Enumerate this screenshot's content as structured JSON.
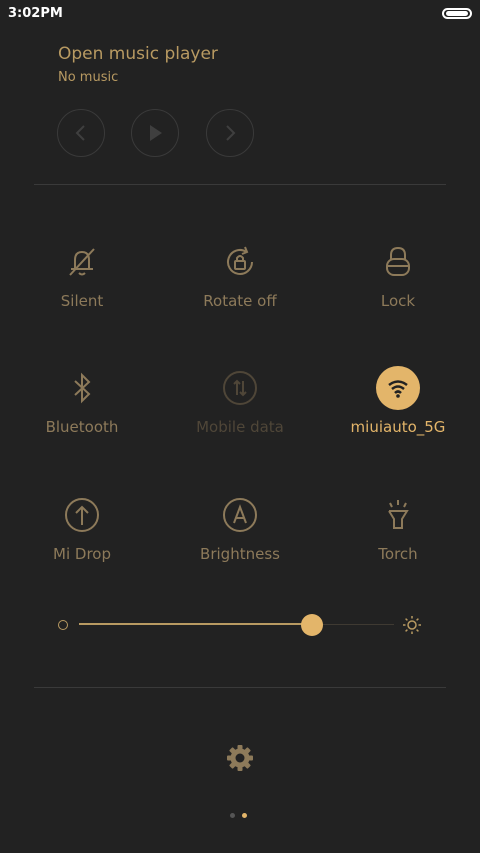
{
  "status": {
    "time": "3:02PM"
  },
  "music": {
    "title": "Open music player",
    "subtitle": "No music"
  },
  "tiles": [
    {
      "label": "Silent",
      "icon": "bell-off-icon",
      "state": "off"
    },
    {
      "label": "Rotate off",
      "icon": "rotate-lock-icon",
      "state": "off"
    },
    {
      "label": "Lock",
      "icon": "lock-icon",
      "state": "off"
    },
    {
      "label": "Bluetooth",
      "icon": "bluetooth-icon",
      "state": "off"
    },
    {
      "label": "Mobile data",
      "icon": "mobile-data-icon",
      "state": "disabled"
    },
    {
      "label": "miuiauto_5G",
      "icon": "wifi-icon",
      "state": "on"
    },
    {
      "label": "Mi Drop",
      "icon": "mi-drop-icon",
      "state": "off"
    },
    {
      "label": "Brightness",
      "icon": "auto-brightness-icon",
      "state": "off"
    },
    {
      "label": "Torch",
      "icon": "torch-icon",
      "state": "off"
    }
  ],
  "brightness": {
    "level": 0.74
  },
  "pager": {
    "pages": 2,
    "current": 2
  },
  "colors": {
    "accent": "#e3b56a",
    "icon": "#8d7a5a",
    "background": "#222222"
  }
}
